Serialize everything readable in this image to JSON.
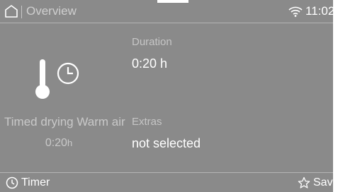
{
  "header": {
    "title": "Overview",
    "time": "11:02"
  },
  "program": {
    "name": "Timed drying Warm air",
    "duration_value": "0:20",
    "duration_unit": "h"
  },
  "settings": {
    "duration_label": "Duration",
    "duration_value": "0:20 h",
    "extras_label": "Extras",
    "extras_value": "not selected"
  },
  "footer": {
    "timer_label": "Timer",
    "save_label": "Save"
  },
  "icons": {
    "home": "home-icon",
    "wifi": "wifi-icon",
    "program": "thermometer-clock-icon",
    "timer": "clock-icon",
    "save": "star-icon"
  },
  "colors": {
    "background": "#8a8a8a",
    "text_primary": "#ffffff",
    "text_secondary": "#c9c9c9"
  }
}
